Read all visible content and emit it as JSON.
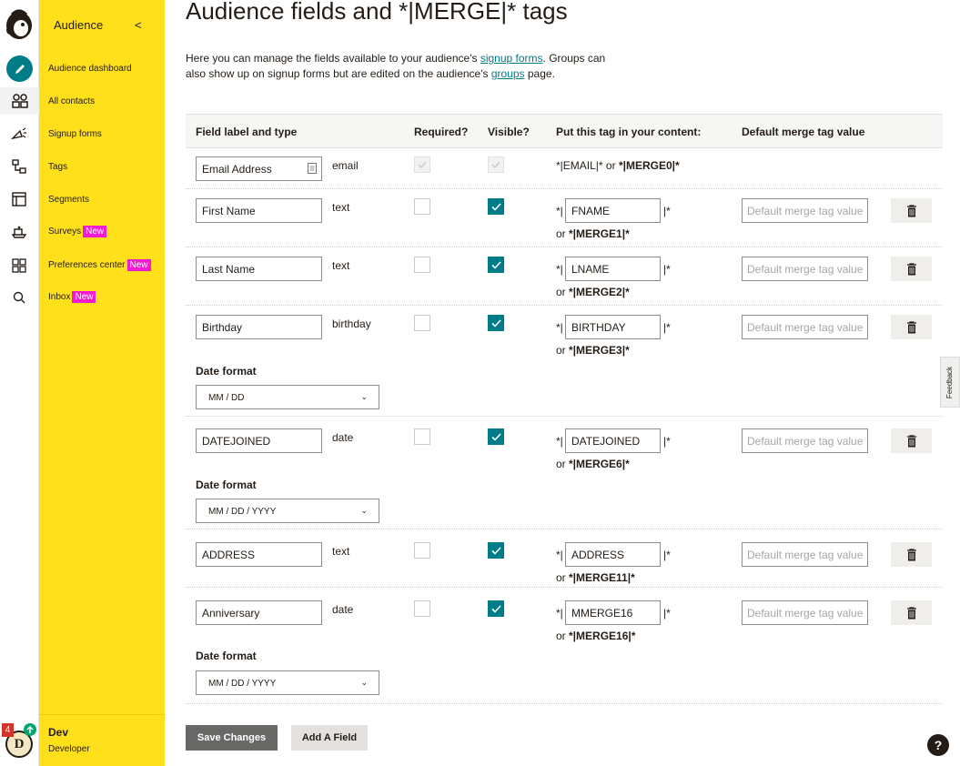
{
  "rail": {
    "notifications": "4",
    "avatar_initial": "D"
  },
  "sidebar": {
    "heading": "Audience",
    "collapse_glyph": "<",
    "items": [
      {
        "label": "Audience dashboard",
        "badge": ""
      },
      {
        "label": "All contacts",
        "badge": ""
      },
      {
        "label": "Signup forms",
        "badge": ""
      },
      {
        "label": "Tags",
        "badge": ""
      },
      {
        "label": "Segments",
        "badge": ""
      },
      {
        "label": "Surveys",
        "badge": "New"
      },
      {
        "label": "Preferences center",
        "badge": "New"
      },
      {
        "label": "Inbox",
        "badge": "New"
      }
    ],
    "user_name": "Dev",
    "user_role": "Developer"
  },
  "page": {
    "title": "Audience fields and *|MERGE|* tags",
    "intro_1": "Here you can manage the fields available to your audience's ",
    "intro_link_1": "signup forms",
    "intro_2": ". Groups can also show up on signup forms but are edited on the audience's ",
    "intro_link_2": "groups",
    "intro_3": " page."
  },
  "table": {
    "headers": {
      "label": "Field label and type",
      "required": "Required?",
      "visible": "Visible?",
      "tag": "Put this tag in your content:",
      "default": "Default merge tag value"
    },
    "email_row": {
      "label": "Email Address",
      "type": "email",
      "tag_a": "*|EMAIL|* or ",
      "tag_b": "*|MERGE0|*"
    },
    "tag_prefix": "*|",
    "tag_suffix": "|*",
    "or_text": "or ",
    "default_placeholder": "Default merge tag value",
    "date_format_label": "Date format",
    "rows": [
      {
        "label": "First Name",
        "type": "text",
        "tag": "FNAME",
        "merge": "*|MERGE1|*",
        "required": false,
        "visible": true
      },
      {
        "label": "Last Name",
        "type": "text",
        "tag": "LNAME",
        "merge": "*|MERGE2|*",
        "required": false,
        "visible": true
      },
      {
        "label": "Birthday",
        "type": "birthday",
        "tag": "BIRTHDAY",
        "merge": "*|MERGE3|*",
        "required": false,
        "visible": true,
        "date_format": "MM / DD"
      },
      {
        "label": "DATEJOINED",
        "type": "date",
        "tag": "DATEJOINED",
        "merge": "*|MERGE6|*",
        "required": false,
        "visible": true,
        "date_format": "MM / DD / YYYY"
      },
      {
        "label": "ADDRESS",
        "type": "text",
        "tag": "ADDRESS",
        "merge": "*|MERGE11|*",
        "required": false,
        "visible": true
      },
      {
        "label": "Anniversary",
        "type": "date",
        "tag": "MMERGE16",
        "merge": "*|MERGE16|*",
        "required": false,
        "visible": true,
        "date_format": "MM / DD / YYYY"
      }
    ]
  },
  "actions": {
    "save": "Save Changes",
    "add": "Add A Field"
  },
  "feedback": "Feedback",
  "help": "?",
  "colors": {
    "sidebar": "#ffe01b",
    "accent": "#007c89",
    "badge": "#f41ad1"
  }
}
